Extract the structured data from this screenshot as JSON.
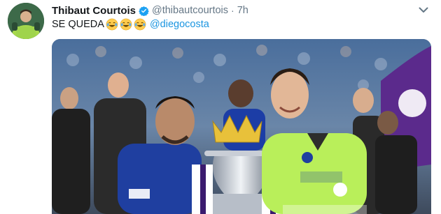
{
  "tweet": {
    "author_name": "Thibaut Courtois",
    "handle": "@thibautcourtois",
    "separator": "·",
    "time": "7h",
    "text": "SE QUEDA",
    "emojis": [
      "joy-emoji",
      "joy-emoji",
      "joy-emoji"
    ],
    "mention": "@diegocosta",
    "verified_icon": "verified-badge-icon",
    "menu_icon": "chevron-down-icon"
  },
  "colors": {
    "link": "#1b95e0",
    "secondary_text": "#657786",
    "verified": "#1da1f2",
    "chelsea_blue": "#1f3fa0",
    "keeper_green": "#b9ef5a"
  }
}
